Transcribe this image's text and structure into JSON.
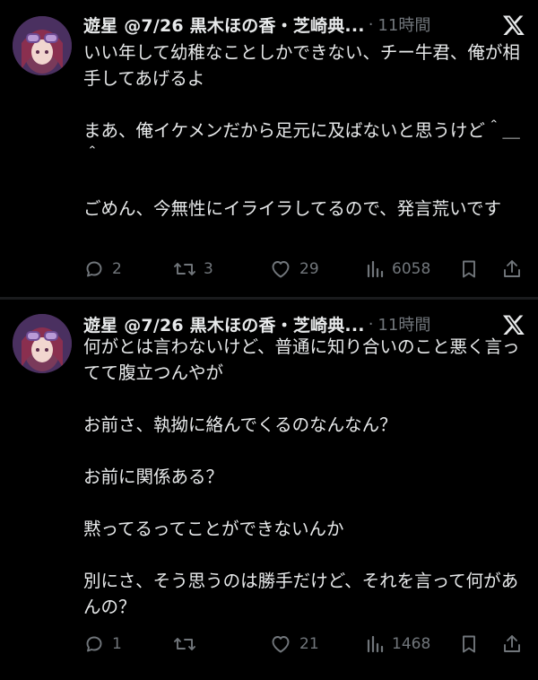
{
  "tweets": [
    {
      "author": "遊星 @7/26 黒木ほの香・芝崎典...",
      "separator": "·",
      "time": "11時間",
      "text": "いい年して幼稚なことしかできない、チー牛君、俺が相手してあげるよ\n\nまあ、俺イケメンだから足元に及ばないと思うけど＾＿＾\n\nごめん、今無性にイライラしてるので、発言荒いです",
      "replies": "2",
      "retweets": "3",
      "likes": "29",
      "views": "6058"
    },
    {
      "author": "遊星 @7/26 黒木ほの香・芝崎典...",
      "separator": "·",
      "time": "11時間",
      "text": "何がとは言わないけど、普通に知り合いのこと悪く言ってて腹立つんやが\n\nお前さ、執拗に絡んでくるのなんなん？\n\nお前に関係ある？\n\n黙ってるってことができないんか\n\n別にさ、そう思うのは勝手だけど、それを言って何があんの？",
      "replies": "1",
      "retweets": "",
      "likes": "21",
      "views": "1468"
    }
  ],
  "icons": {
    "platform": "x-logo-icon",
    "reply": "reply-icon",
    "retweet": "retweet-icon",
    "like": "heart-icon",
    "views": "views-chart-icon",
    "bookmark": "bookmark-icon",
    "share": "share-icon"
  },
  "colors": {
    "background": "#000000",
    "text": "#e7e9ea",
    "muted": "#71767b",
    "divider": "#1a1b1d"
  }
}
